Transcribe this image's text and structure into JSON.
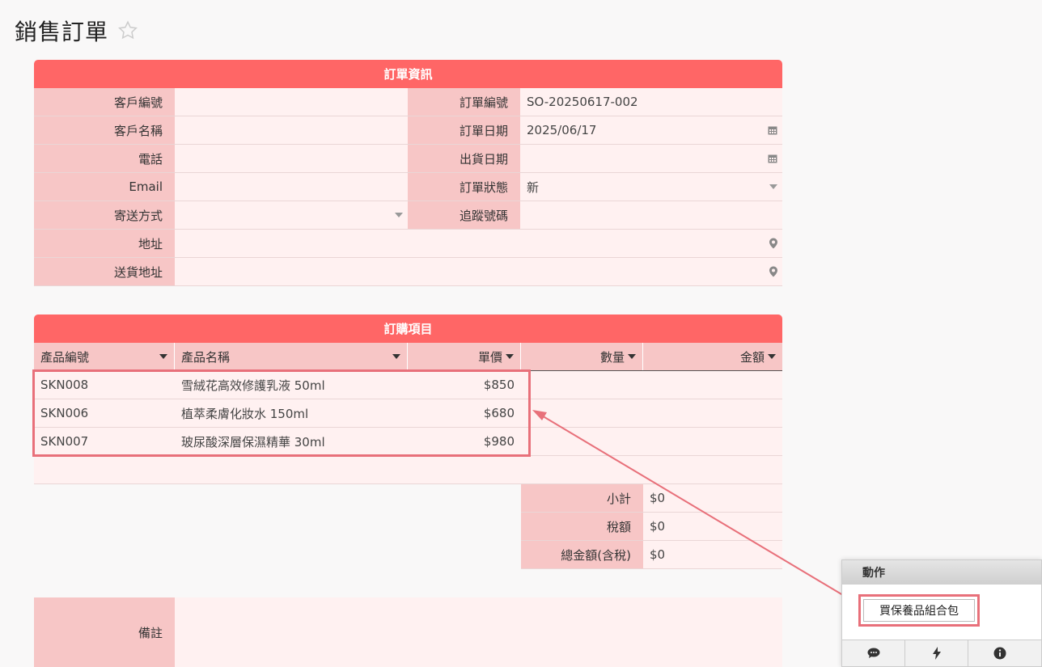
{
  "page": {
    "title": "銷售訂單"
  },
  "order_info": {
    "header": "訂單資訊",
    "fields": {
      "customer_no": {
        "label": "客戶編號",
        "value": ""
      },
      "order_no": {
        "label": "訂單編號",
        "value": "SO-20250617-002"
      },
      "customer_name": {
        "label": "客戶名稱",
        "value": ""
      },
      "order_date": {
        "label": "訂單日期",
        "value": "2025/06/17"
      },
      "phone": {
        "label": "電話",
        "value": ""
      },
      "ship_date": {
        "label": "出貨日期",
        "value": ""
      },
      "email": {
        "label": "Email",
        "value": ""
      },
      "order_status": {
        "label": "訂單狀態",
        "value": "新"
      },
      "shipping_method": {
        "label": "寄送方式",
        "value": ""
      },
      "tracking_no": {
        "label": "追蹤號碼",
        "value": ""
      },
      "address": {
        "label": "地址",
        "value": ""
      },
      "delivery_address": {
        "label": "送貨地址",
        "value": ""
      }
    }
  },
  "order_items": {
    "header": "訂購項目",
    "columns": [
      "產品編號",
      "產品名稱",
      "單價",
      "數量",
      "金額"
    ],
    "rows": [
      {
        "code": "SKN008",
        "name": "雪絨花高效修護乳液 50ml",
        "price": "$850",
        "qty": "",
        "amount": ""
      },
      {
        "code": "SKN006",
        "name": "植萃柔膚化妝水 150ml",
        "price": "$680",
        "qty": "",
        "amount": ""
      },
      {
        "code": "SKN007",
        "name": "玻尿酸深層保濕精華 30ml",
        "price": "$980",
        "qty": "",
        "amount": ""
      },
      {
        "code": "",
        "name": "",
        "price": "",
        "qty": "",
        "amount": ""
      }
    ],
    "totals": {
      "subtotal": {
        "label": "小計",
        "value": "$0"
      },
      "tax": {
        "label": "稅額",
        "value": "$0"
      },
      "total": {
        "label": "總金額(含稅)",
        "value": "$0"
      }
    }
  },
  "notes": {
    "label": "備註",
    "value": ""
  },
  "action_panel": {
    "title": "動作",
    "button_label": "買保養品組合包",
    "footer_icons": [
      "comment-icon",
      "bolt-icon",
      "info-icon"
    ]
  },
  "colors": {
    "section_header": "#ff6666",
    "label_bg": "#f7c6c6",
    "value_bg": "#fff1f1",
    "highlight": "#e8707a"
  }
}
